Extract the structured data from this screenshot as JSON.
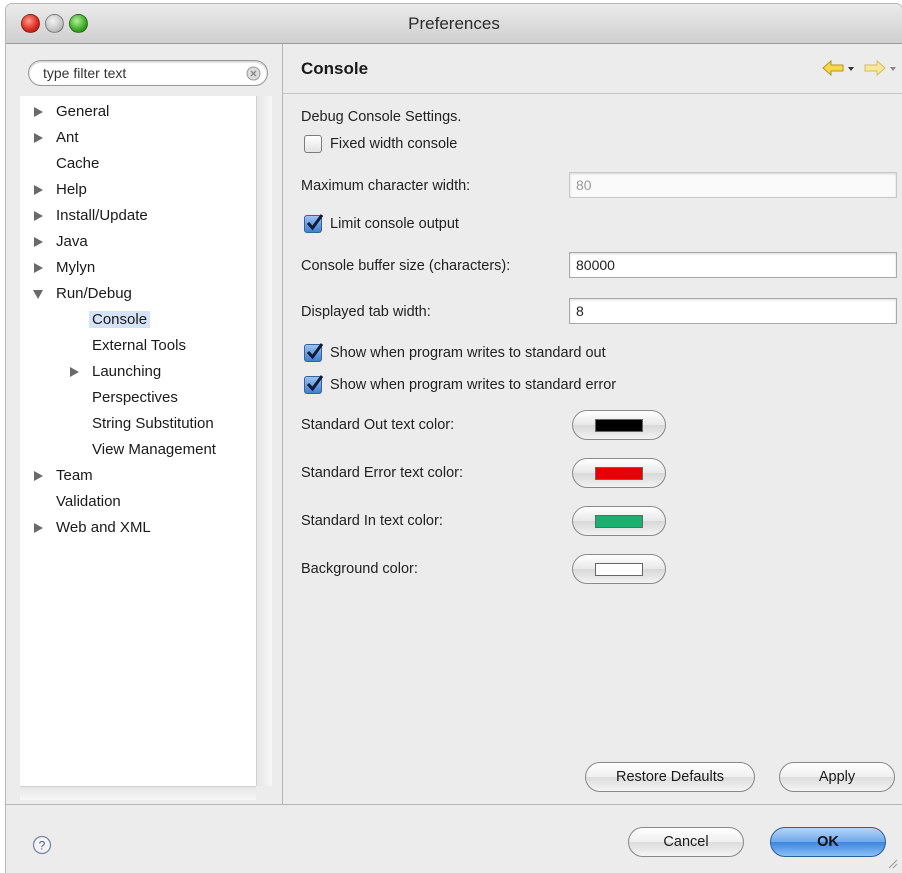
{
  "window": {
    "title": "Preferences"
  },
  "search": {
    "placeholder": "type filter text"
  },
  "tree": {
    "items": [
      {
        "label": "General",
        "expandable": true
      },
      {
        "label": "Ant",
        "expandable": true
      },
      {
        "label": "Cache",
        "expandable": false
      },
      {
        "label": "Help",
        "expandable": true
      },
      {
        "label": "Install/Update",
        "expandable": true
      },
      {
        "label": "Java",
        "expandable": true
      },
      {
        "label": "Mylyn",
        "expandable": true
      },
      {
        "label": "Run/Debug",
        "expandable": true,
        "expanded": true
      },
      {
        "label": "Console",
        "selected": true
      },
      {
        "label": "External Tools"
      },
      {
        "label": "Launching",
        "expandable": true
      },
      {
        "label": "Perspectives"
      },
      {
        "label": "String Substitution"
      },
      {
        "label": "View Management"
      },
      {
        "label": "Team",
        "expandable": true
      },
      {
        "label": "Validation",
        "expandable": false
      },
      {
        "label": "Web and XML",
        "expandable": true
      }
    ]
  },
  "page": {
    "title": "Console",
    "section_label": "Debug Console Settings.",
    "fixed_width": {
      "label": "Fixed width console",
      "checked": false
    },
    "max_char_width": {
      "label": "Maximum character width:",
      "value": "80"
    },
    "limit_output": {
      "label": "Limit console output",
      "checked": true
    },
    "buffer_size": {
      "label": "Console buffer size (characters):",
      "value": "80000"
    },
    "tab_width": {
      "label": "Displayed tab width:",
      "value": "8"
    },
    "show_stdout": {
      "label": "Show when program writes to standard out",
      "checked": true
    },
    "show_stderr": {
      "label": "Show when program writes to standard error",
      "checked": true
    },
    "colors": [
      {
        "label": "Standard Out text color:",
        "color": "#000000"
      },
      {
        "label": "Standard Error text color:",
        "color": "#e60000"
      },
      {
        "label": "Standard In text color:",
        "color": "#1fae6e"
      },
      {
        "label": "Background color:",
        "color": "#ffffff"
      }
    ],
    "restore_defaults_label": "Restore Defaults",
    "apply_label": "Apply"
  },
  "footer": {
    "help_icon": "help-icon",
    "cancel_label": "Cancel",
    "ok_label": "OK"
  },
  "colors": {
    "accent": "#3c86e0",
    "selection": "#d5e3f7"
  }
}
